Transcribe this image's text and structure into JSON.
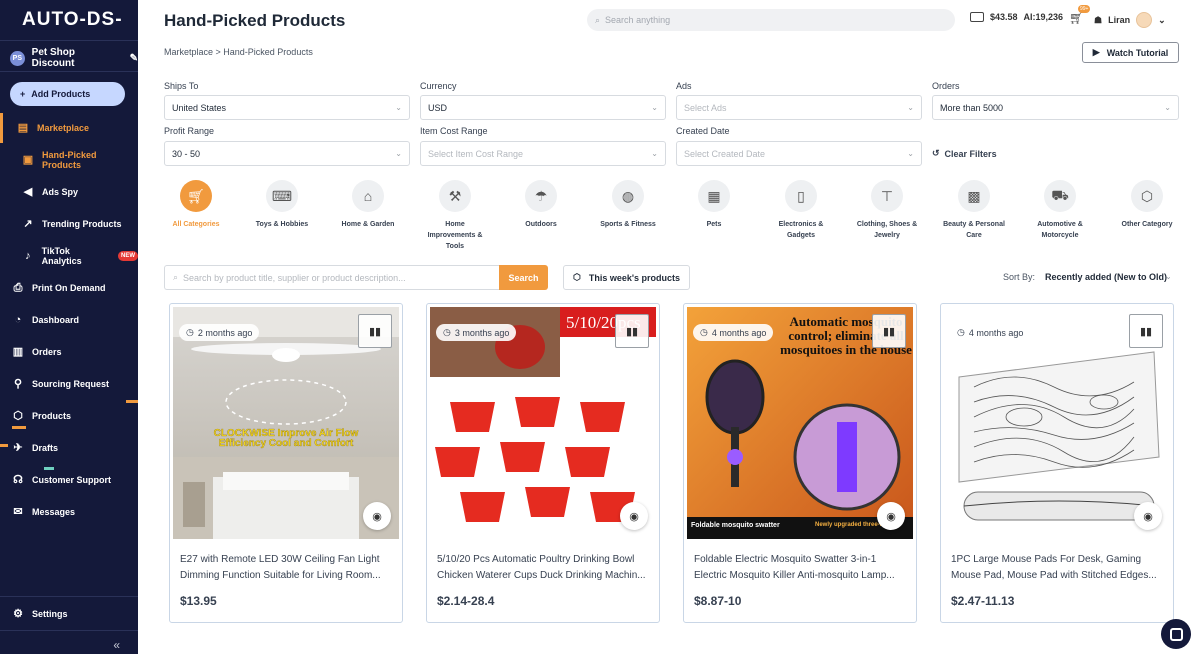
{
  "brand": {
    "logo": "AUTO-DS-"
  },
  "store": {
    "initials": "PS",
    "name": "Pet Shop Discount"
  },
  "sidebar": {
    "add_products": "Add Products",
    "items": [
      {
        "label": "Marketplace",
        "icon": "store-icon"
      },
      {
        "label": "Hand-Picked Products",
        "icon": "box-icon"
      },
      {
        "label": "Ads Spy",
        "icon": "megaphone-icon"
      },
      {
        "label": "Trending Products",
        "icon": "trend-icon"
      },
      {
        "label": "TikTok Analytics",
        "icon": "tiktok-icon",
        "badge": "NEW"
      },
      {
        "label": "Print On Demand",
        "icon": "printer-icon"
      },
      {
        "label": "Dashboard",
        "icon": "gauge-icon"
      },
      {
        "label": "Orders",
        "icon": "orders-icon"
      },
      {
        "label": "Sourcing Request",
        "icon": "sourcing-icon"
      },
      {
        "label": "Products",
        "icon": "products-icon"
      },
      {
        "label": "Drafts",
        "icon": "drafts-icon"
      },
      {
        "label": "Customer Support",
        "icon": "support-icon"
      },
      {
        "label": "Messages",
        "icon": "mail-icon"
      }
    ],
    "settings": "Settings",
    "collapse": "«"
  },
  "header": {
    "title": "Hand-Picked Products",
    "search_placeholder": "Search anything",
    "balance": "$43.58",
    "ai_credits": "AI:19,236",
    "cart_badge": "99+",
    "user": "Liran"
  },
  "breadcrumb": "Marketplace > Hand-Picked Products",
  "watch_tutorial": "Watch Tutorial",
  "filters": {
    "ships_to": {
      "label": "Ships To",
      "value": "United States"
    },
    "currency": {
      "label": "Currency",
      "value": "USD"
    },
    "ads": {
      "label": "Ads",
      "placeholder": "Select Ads"
    },
    "orders": {
      "label": "Orders",
      "value": "More than 5000"
    },
    "profit_range": {
      "label": "Profit Range",
      "value": "30 - 50"
    },
    "item_cost_range": {
      "label": "Item Cost Range",
      "placeholder": "Select Item Cost Range"
    },
    "created_date": {
      "label": "Created Date",
      "placeholder": "Select Created Date"
    },
    "clear": "Clear Filters"
  },
  "categories": [
    {
      "label": "All Categories",
      "icon": "cart-icon",
      "active": true
    },
    {
      "label": "Toys & Hobbies",
      "icon": "gamepad-icon"
    },
    {
      "label": "Home & Garden",
      "icon": "house-icon"
    },
    {
      "label": "Home Improvements & Tools",
      "icon": "tools-icon"
    },
    {
      "label": "Outdoors",
      "icon": "umbrella-icon"
    },
    {
      "label": "Sports & Fitness",
      "icon": "ball-icon"
    },
    {
      "label": "Pets",
      "icon": "pets-icon"
    },
    {
      "label": "Electronics & Gadgets",
      "icon": "phone-icon"
    },
    {
      "label": "Clothing, Shoes & Jewelry",
      "icon": "shirt-icon"
    },
    {
      "label": "Beauty & Personal Care",
      "icon": "beauty-icon"
    },
    {
      "label": "Automotive & Motorcycle",
      "icon": "car-icon"
    },
    {
      "label": "Other Category",
      "icon": "cube-icon"
    }
  ],
  "product_search": {
    "placeholder": "Search by product title, supplier or product description...",
    "button": "Search"
  },
  "week_button": "This week's products",
  "sort": {
    "label": "Sort By:",
    "value": "Recently added (New to Old)"
  },
  "products": [
    {
      "age": "2 months ago",
      "title": "E27 with Remote LED 30W Ceiling Fan Light Dimming Function Suitable for Living Room...",
      "price": "$13.95",
      "image_text": "CLOCKWISE Improve Air Flow Efficiency Cool and Comfort"
    },
    {
      "age": "3 months ago",
      "title": "5/10/20 Pcs Automatic Poultry Drinking Bowl Chicken Waterer Cups Duck Drinking Machin...",
      "price": "$2.14-28.4",
      "image_text": "5/10/20pcs"
    },
    {
      "age": "4 months ago",
      "title": "Foldable Electric Mosquito Swatter 3-in-1 Electric Mosquito Killer Anti-mosquito Lamp...",
      "price": "$8.87-10",
      "image_text": "Automatic mosquito control; eliminate all mosquitoes in the house",
      "image_caption": "Foldable mosquito swatter",
      "image_caption2": "Newly upgraded three-in-one"
    },
    {
      "age": "4 months ago",
      "title": "1PC Large Mouse Pads For Desk, Gaming Mouse Pad, Mouse Pad with Stitched Edges...",
      "price": "$2.47-11.13"
    }
  ]
}
